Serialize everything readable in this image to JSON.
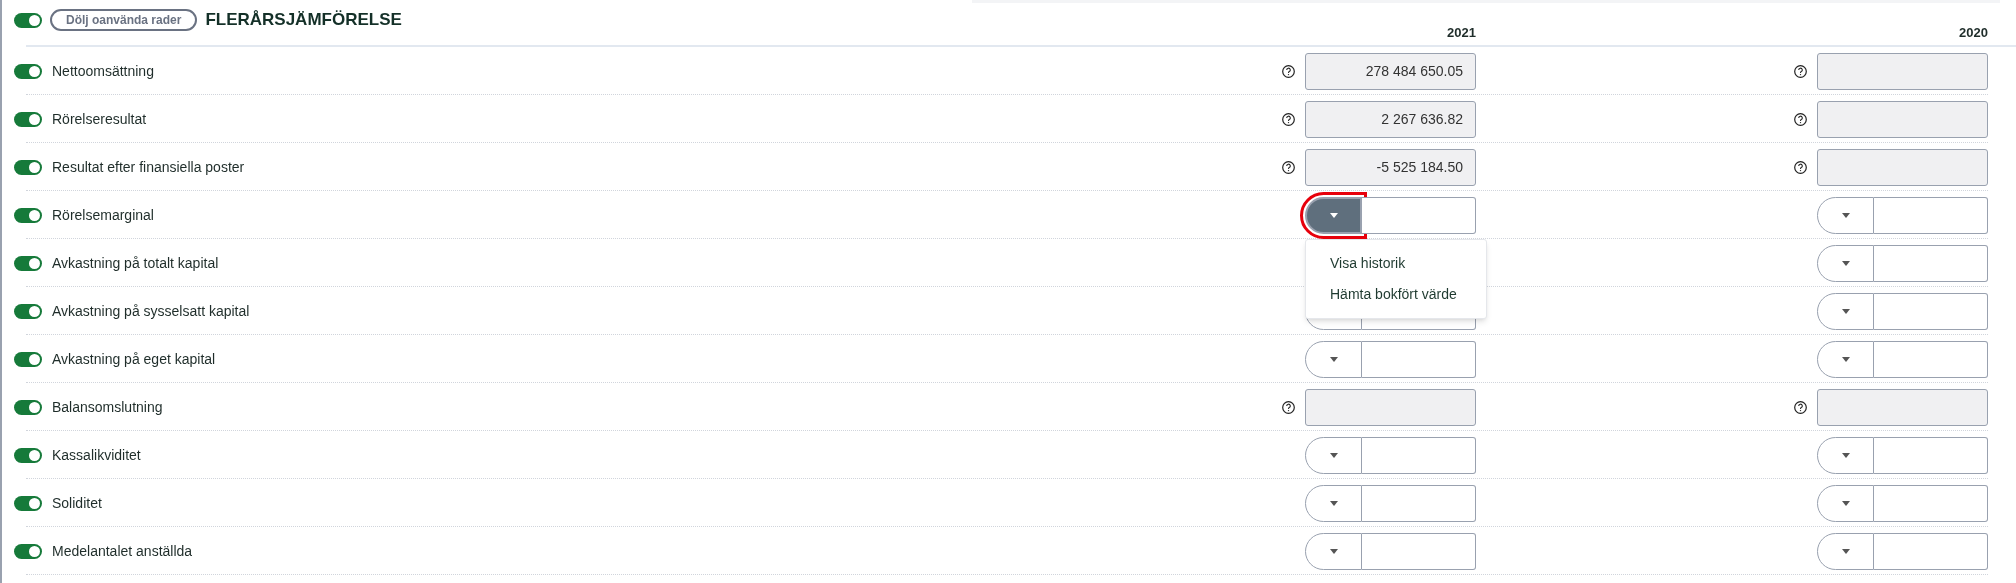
{
  "header": {
    "toggle": {
      "on": true
    },
    "hide_button": "Dölj oanvända rader",
    "title": "FLERÅRSJÄMFÖRELSE",
    "years": [
      "2021",
      "2020"
    ]
  },
  "rows": [
    {
      "label": "Nettoomsättning",
      "on": true,
      "cells": [
        {
          "kind": "readonly",
          "value": "278 484 650.05"
        },
        {
          "kind": "readonly"
        }
      ]
    },
    {
      "label": "Rörelseresultat",
      "on": true,
      "cells": [
        {
          "kind": "readonly",
          "value": "2 267 636.82"
        },
        {
          "kind": "readonly"
        }
      ]
    },
    {
      "label": "Resultat efter finansiella poster",
      "on": true,
      "cells": [
        {
          "kind": "readonly",
          "value": "-5 525 184.50"
        },
        {
          "kind": "readonly"
        }
      ]
    },
    {
      "label": "Rörelsemarginal",
      "on": true,
      "cells": [
        {
          "kind": "dropdown",
          "open": true,
          "menu": [
            "Visa historik",
            "Hämta bokfört värde"
          ]
        },
        {
          "kind": "dropdown",
          "open": false
        }
      ]
    },
    {
      "label": "Avkastning på totalt kapital",
      "on": true,
      "cells": [
        {
          "kind": "hidden"
        },
        {
          "kind": "dropdown",
          "open": false
        }
      ]
    },
    {
      "label": "Avkastning på sysselsatt kapital",
      "on": true,
      "cells": [
        {
          "kind": "dropdown",
          "open": false
        },
        {
          "kind": "dropdown",
          "open": false
        }
      ]
    },
    {
      "label": "Avkastning på eget kapital",
      "on": true,
      "cells": [
        {
          "kind": "dropdown",
          "open": false
        },
        {
          "kind": "dropdown",
          "open": false
        }
      ]
    },
    {
      "label": "Balansomslutning",
      "on": true,
      "cells": [
        {
          "kind": "readonly"
        },
        {
          "kind": "readonly"
        }
      ]
    },
    {
      "label": "Kassalikviditet",
      "on": true,
      "cells": [
        {
          "kind": "dropdown",
          "open": false
        },
        {
          "kind": "dropdown",
          "open": false
        }
      ]
    },
    {
      "label": "Soliditet",
      "on": true,
      "cells": [
        {
          "kind": "dropdown",
          "open": false
        },
        {
          "kind": "dropdown",
          "open": false
        }
      ]
    },
    {
      "label": "Medelantalet anställda",
      "on": true,
      "cells": [
        {
          "kind": "dropdown",
          "open": false
        },
        {
          "kind": "dropdown",
          "open": false
        }
      ]
    }
  ]
}
